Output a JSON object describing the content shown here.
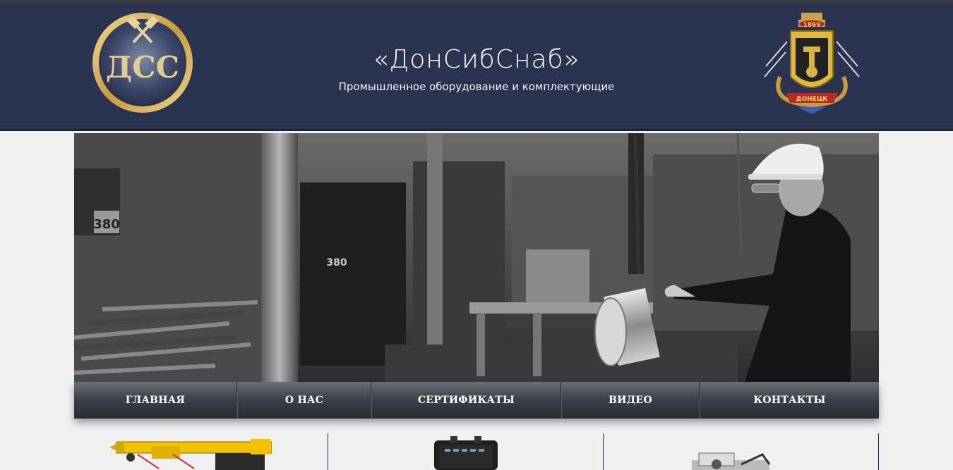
{
  "header": {
    "title": "«ДонСибСнаб»",
    "subtitle": "Промышленное оборудование и комплектующие",
    "logo_text": "ДСС",
    "crest_year": "1869",
    "crest_ribbon": "ДОНЕЦК"
  },
  "hero": {
    "sign_1": "380",
    "sign_2": "380"
  },
  "nav": {
    "items": [
      "ГЛАВНАЯ",
      "О НАС",
      "СЕРТИФИКАТЫ",
      "ВИДЕО",
      "КОНТАКТЫ"
    ]
  },
  "colors": {
    "header_bg": "#2a3350",
    "nav_text": "#ffffff",
    "accent_gold": "#d6b25e"
  }
}
